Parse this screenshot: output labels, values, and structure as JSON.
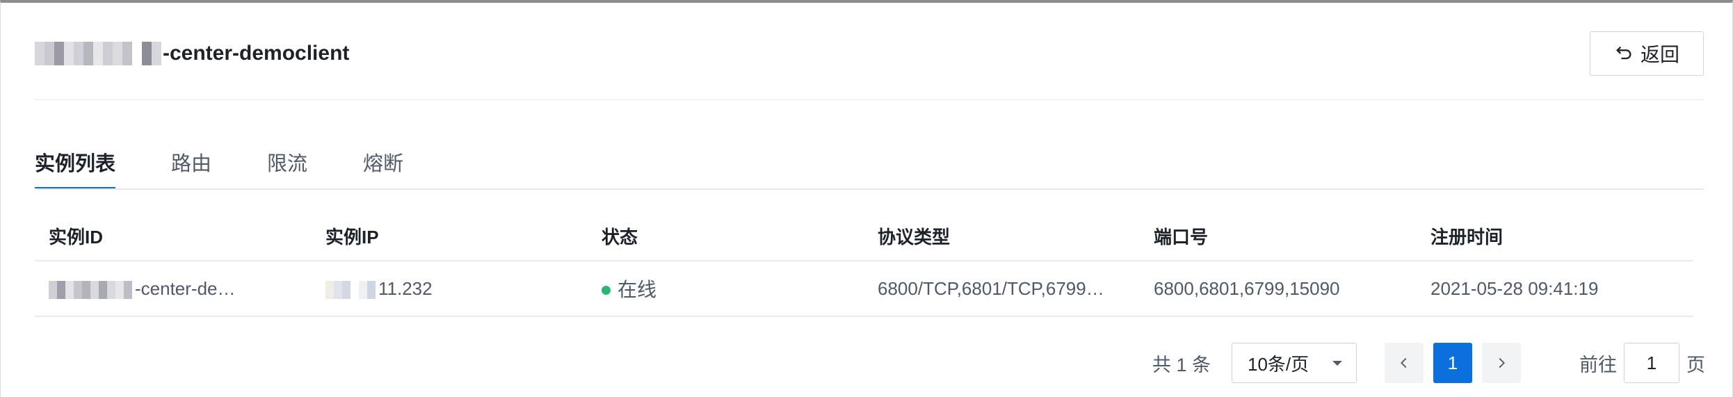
{
  "header": {
    "title_suffix": "-center-democlient",
    "back_label": "返回"
  },
  "tabs": [
    {
      "label": "实例列表",
      "active": true
    },
    {
      "label": "路由",
      "active": false
    },
    {
      "label": "限流",
      "active": false
    },
    {
      "label": "熔断",
      "active": false
    }
  ],
  "table": {
    "columns": [
      "实例ID",
      "实例IP",
      "状态",
      "协议类型",
      "端口号",
      "注册时间"
    ],
    "rows": [
      {
        "instance_id_suffix": "-center-de…",
        "ip_suffix": "11.232",
        "status": "在线",
        "protocol": "6800/TCP,6801/TCP,6799…",
        "ports": "6800,6801,6799,15090",
        "registered_at": "2021-05-28 09:41:19"
      }
    ]
  },
  "pagination": {
    "total_text": "共 1 条",
    "page_size": "10条/页",
    "current_page": "1",
    "goto_label": "前往",
    "goto_value": "1",
    "goto_unit": "页"
  },
  "colors": {
    "accent": "#0b6fde",
    "status_online": "#2bb673"
  },
  "icons": {
    "back": "undo-arrow-icon",
    "prev": "chevron-left-icon",
    "next": "chevron-right-icon",
    "select": "caret-down-icon"
  }
}
